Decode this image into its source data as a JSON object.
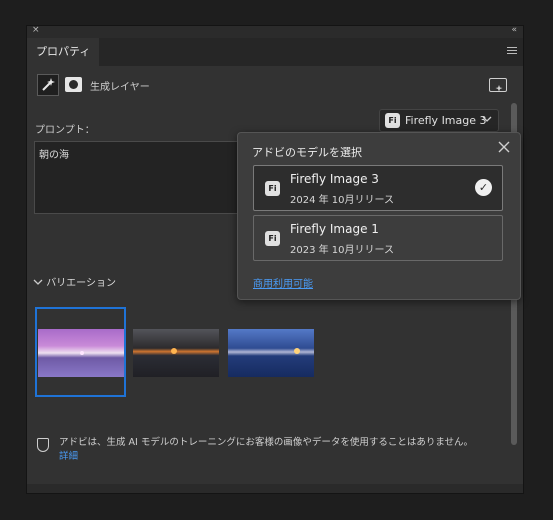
{
  "window": {
    "close_glyph": "×",
    "collapse_glyph": "«"
  },
  "tab": {
    "label": "プロパティ"
  },
  "layer": {
    "label": "生成レイヤー"
  },
  "prompt": {
    "label": "プロンプト：",
    "value": "朝の海"
  },
  "model_dropdown": {
    "badge": "Fi",
    "selected": "Firefly Image 3"
  },
  "variations": {
    "header": "バリエーション",
    "count": 3,
    "selected_index": 0
  },
  "notice": {
    "text": "アドビは、生成 AI モデルのトレーニングにお客様の画像やデータを使用することはありません。",
    "link": "詳細"
  },
  "popover": {
    "title": "アドビのモデルを選択",
    "options": [
      {
        "badge": "Fi",
        "name": "Firefly Image 3",
        "date": "2024 年 10月リリース",
        "selected": true
      },
      {
        "badge": "Fi",
        "name": "Firefly Image 1",
        "date": "2023 年 10月リリース",
        "selected": false
      }
    ],
    "link": "商用利用可能"
  },
  "icons": {
    "wand": "magic-wand-icon",
    "mask": "mask-icon",
    "generate": "generate-icon",
    "shield": "shield-icon",
    "close": "close-icon",
    "check": "check-icon",
    "chevron": "chevron-down-icon",
    "menu": "hamburger-icon"
  },
  "colors": {
    "accent_blue": "#1f73d6",
    "link_blue": "#4a9bf5",
    "panel_bg": "#323232"
  }
}
